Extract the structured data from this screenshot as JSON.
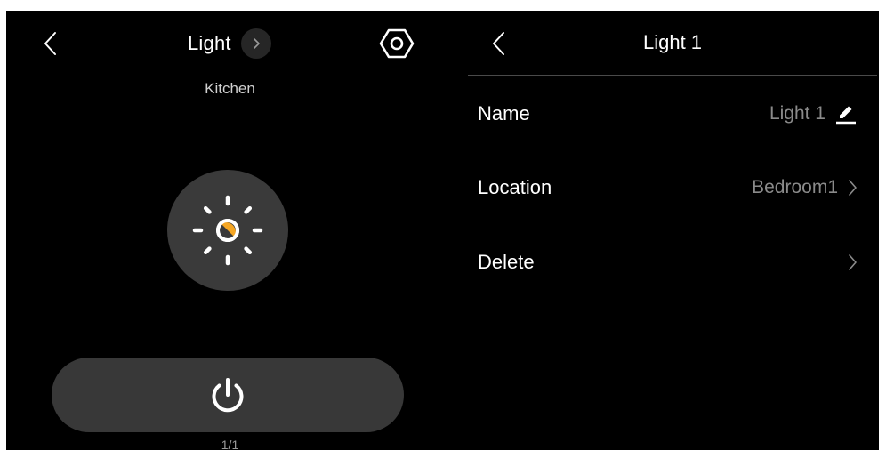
{
  "device_panel": {
    "title": "Light",
    "room": "Kitchen",
    "pager": "1/1",
    "icons": {
      "back": "chevron-left-icon",
      "title_more": "chevron-right-icon",
      "settings": "hexagon-gear-icon",
      "light": "sun-brightness-icon",
      "power": "power-icon"
    },
    "colors": {
      "accent": "#f5a623",
      "circle": "#3a3a3a",
      "power_bar": "#383838"
    }
  },
  "settings_panel": {
    "title": "Light 1",
    "rows": [
      {
        "label": "Name",
        "value": "Light 1",
        "icon": "edit-pencil-icon"
      },
      {
        "label": "Location",
        "value": "Bedroom1",
        "icon": "chevron-right-icon"
      },
      {
        "label": "Delete",
        "value": "",
        "icon": "chevron-right-icon"
      }
    ]
  }
}
